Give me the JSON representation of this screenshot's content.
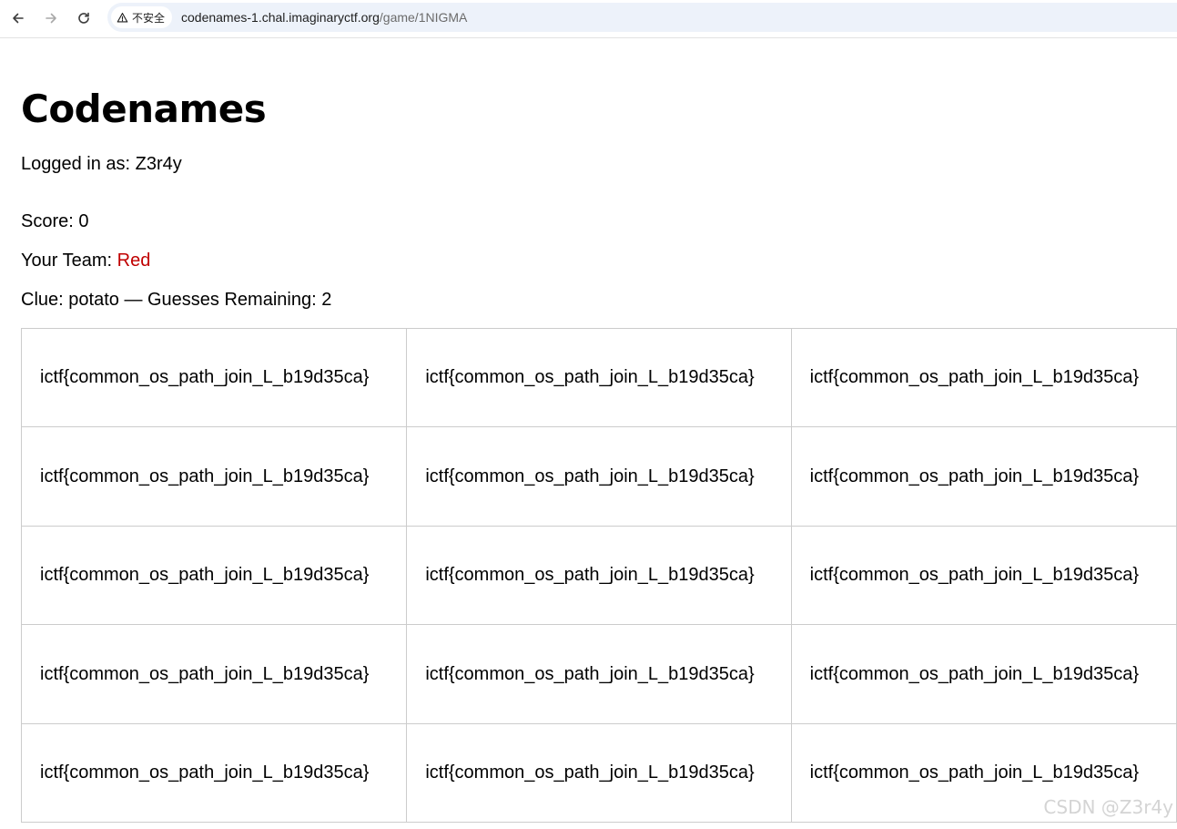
{
  "browser": {
    "security_label": "不安全",
    "url_host": "codenames-1.chal.imaginaryctf.org",
    "url_path": "/game/1NIGMA",
    "icons": [
      "back-arrow-icon",
      "forward-arrow-icon",
      "reload-icon",
      "warning-triangle-icon"
    ]
  },
  "page": {
    "title": "Codenames",
    "login_label": "Logged in as:",
    "username": "Z3r4y",
    "score_label": "Score:",
    "score_value": "0",
    "team_label": "Your Team:",
    "team_value": "Red",
    "team_color": "#c00000",
    "clue_label": "Clue:",
    "clue_value": "potato",
    "separator": "—",
    "guesses_label": "Guesses Remaining:",
    "guesses_value": "2"
  },
  "board": {
    "rows": [
      [
        "ictf{common_os_path_join_L_b19d35ca}",
        "ictf{common_os_path_join_L_b19d35ca}",
        "ictf{common_os_path_join_L_b19d35ca}"
      ],
      [
        "ictf{common_os_path_join_L_b19d35ca}",
        "ictf{common_os_path_join_L_b19d35ca}",
        "ictf{common_os_path_join_L_b19d35ca}"
      ],
      [
        "ictf{common_os_path_join_L_b19d35ca}",
        "ictf{common_os_path_join_L_b19d35ca}",
        "ictf{common_os_path_join_L_b19d35ca}"
      ],
      [
        "ictf{common_os_path_join_L_b19d35ca}",
        "ictf{common_os_path_join_L_b19d35ca}",
        "ictf{common_os_path_join_L_b19d35ca}"
      ],
      [
        "ictf{common_os_path_join_L_b19d35ca}",
        "ictf{common_os_path_join_L_b19d35ca}",
        "ictf{common_os_path_join_L_b19d35ca}"
      ]
    ]
  },
  "watermark": "CSDN @Z3r4y"
}
